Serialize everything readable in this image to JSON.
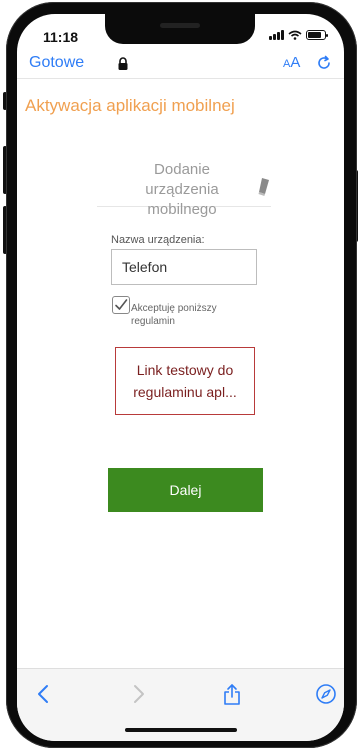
{
  "status_bar": {
    "time": "11:18"
  },
  "browser": {
    "done_label": "Gotowe",
    "text_size_label_small": "A",
    "text_size_label_large": "A",
    "accent_color": "#2f7df6"
  },
  "page": {
    "title": "Aktywacja aplikacji mobilnej",
    "title_color": "#f0a050",
    "device_section_title": "Dodanie urządzenia mobilnego",
    "device_name_label": "Nazwa urządzenia:",
    "device_name_value": "Telefon",
    "accept_terms_label": "Akceptuję poniższy regulamin",
    "accept_terms_checked": true,
    "terms_link_text": "Link testowy do regulaminu apl...",
    "next_button_label": "Dalej",
    "next_button_color": "#3c8a1f"
  },
  "icons": {
    "lock": "lock-icon",
    "reload": "reload-icon",
    "eraser": "eraser-icon",
    "back": "chevron-left-icon",
    "forward": "chevron-right-icon",
    "share": "share-icon",
    "compass": "compass-icon"
  }
}
